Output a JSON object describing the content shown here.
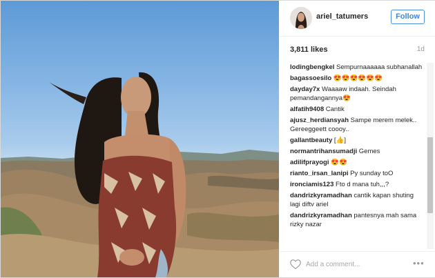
{
  "post": {
    "image_alt": "Photo of a woman with long dark hair in a patterned strapless wrap standing on grassy hills under a blue sky"
  },
  "header": {
    "username": "ariel_tatumers",
    "follow_label": "Follow"
  },
  "stats": {
    "likes": "3,811 likes",
    "time": "1d"
  },
  "comments": [
    {
      "user": "lodingbengkel",
      "text": "Sempurnaaaaaa subhanallah"
    },
    {
      "user": "bagassoesilo",
      "text": "😍😍😍😍😍😍"
    },
    {
      "user": "dayday7x",
      "text": "Waaaaw indaah. Seindah pemandangannya😍"
    },
    {
      "user": "alfatih9408",
      "text": "Cantik"
    },
    {
      "user": "ajusz_herdiansyah",
      "text": "Sampe merem melek.. Gereeggeett coooy.."
    },
    {
      "user": "gallantbeauty",
      "text": "[👍]"
    },
    {
      "user": "normantrihansumadji",
      "text": "Gemes"
    },
    {
      "user": "adilifprayogi",
      "text": "😍😍"
    },
    {
      "user": "rianto_irsan_lanipi",
      "text": "Py sunday toO"
    },
    {
      "user": "ironciamis123",
      "text": "Fto d mana tuh,,,?"
    },
    {
      "user": "dandrizkyramadhan",
      "text": "cantik kapan shuting lagi diftv ariel"
    },
    {
      "user": "dandrizkyramadhan",
      "text": "pantesnya mah sama rizky nazar"
    }
  ],
  "footer": {
    "comment_placeholder": "Add a comment...",
    "more_label": "•••"
  },
  "colors": {
    "follow_blue": "#3f88d4",
    "border": "#efefef"
  },
  "icons": {
    "like": "heart-icon",
    "more": "more-options-icon"
  }
}
